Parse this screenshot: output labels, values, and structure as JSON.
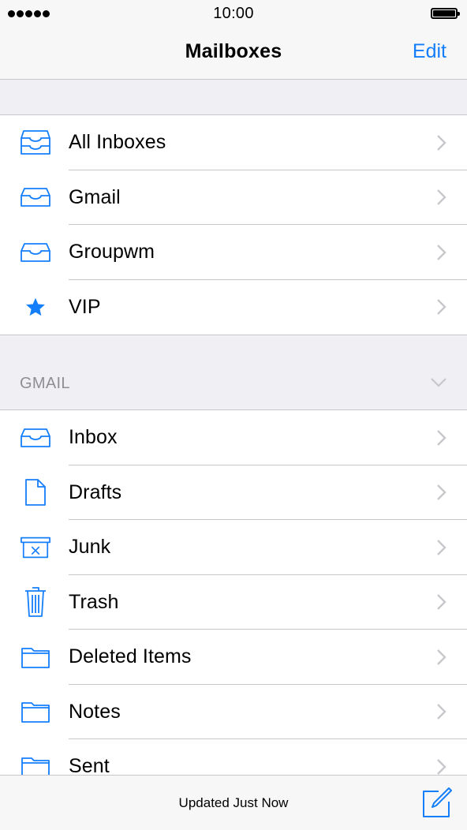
{
  "status_bar": {
    "time": "10:00"
  },
  "nav": {
    "title": "Mailboxes",
    "edit_label": "Edit"
  },
  "mailboxes": [
    {
      "label": "All Inboxes",
      "icon": "all-inboxes-icon"
    },
    {
      "label": "Gmail",
      "icon": "inbox-tray-icon"
    },
    {
      "label": "Groupwm",
      "icon": "inbox-tray-icon"
    },
    {
      "label": "VIP",
      "icon": "star-icon"
    }
  ],
  "gmail_section": {
    "title": "GMAIL",
    "items": [
      {
        "label": "Inbox",
        "icon": "inbox-tray-icon"
      },
      {
        "label": "Drafts",
        "icon": "document-icon"
      },
      {
        "label": "Junk",
        "icon": "junk-bin-icon"
      },
      {
        "label": "Trash",
        "icon": "trash-icon"
      },
      {
        "label": "Deleted Items",
        "icon": "folder-icon"
      },
      {
        "label": "Notes",
        "icon": "folder-icon"
      },
      {
        "label": "Sent",
        "icon": "folder-icon"
      }
    ]
  },
  "toolbar": {
    "status": "Updated Just Now"
  },
  "colors": {
    "accent": "#147efb",
    "separator": "#c8c7cc",
    "background": "#efeff4",
    "secondary_text": "#8e8e93"
  }
}
